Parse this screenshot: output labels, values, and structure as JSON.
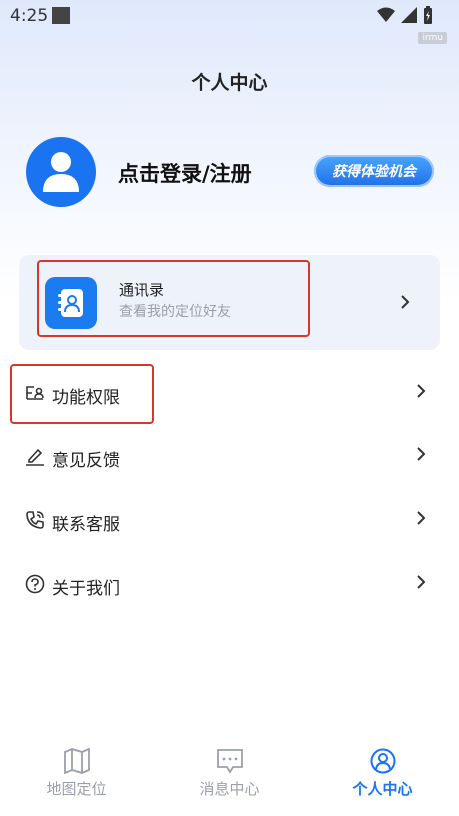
{
  "status_bar": {
    "time": "4:25",
    "tag": "irmu"
  },
  "header": {
    "title": "个人中心"
  },
  "profile": {
    "login_text": "点击登录/注册",
    "trial_button": "获得体验机会"
  },
  "contacts_card": {
    "title": "通讯录",
    "subtitle": "查看我的定位好友"
  },
  "menu": {
    "items": [
      {
        "label": "功能权限",
        "icon": "permissions-icon"
      },
      {
        "label": "意见反馈",
        "icon": "feedback-icon"
      },
      {
        "label": "联系客服",
        "icon": "phone-icon"
      },
      {
        "label": "关于我们",
        "icon": "question-icon"
      }
    ]
  },
  "tabbar": {
    "tabs": [
      {
        "label": "地图定位",
        "icon": "map-icon",
        "active": false
      },
      {
        "label": "消息中心",
        "icon": "message-icon",
        "active": false
      },
      {
        "label": "个人中心",
        "icon": "user-icon",
        "active": true
      }
    ]
  },
  "colors": {
    "accent": "#1a73f0",
    "highlight": "#d9362b"
  }
}
